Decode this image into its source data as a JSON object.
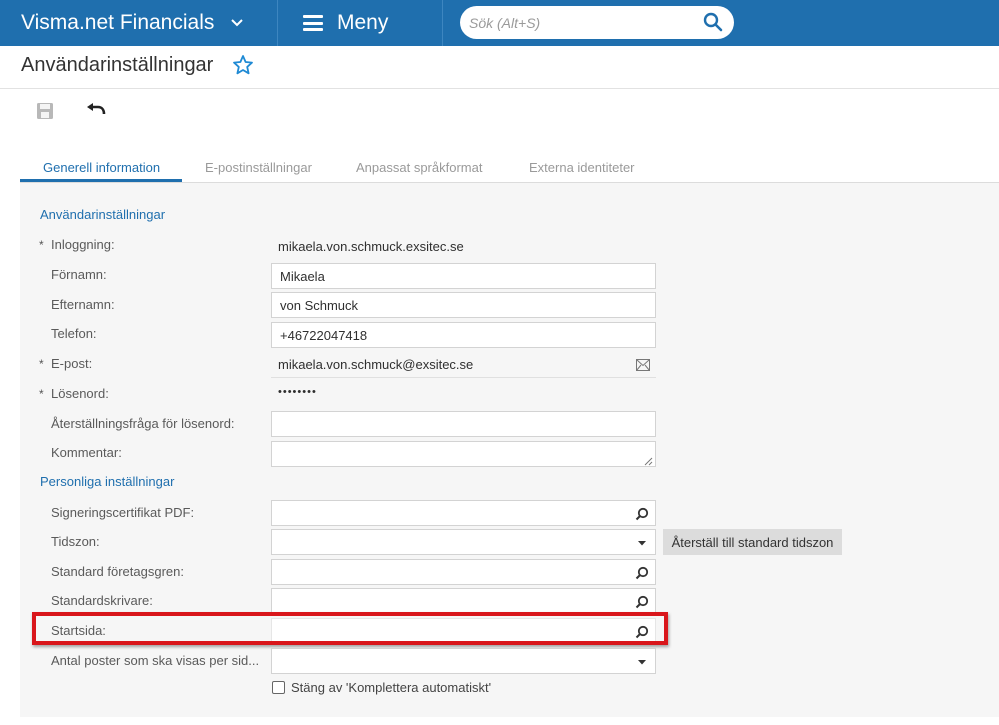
{
  "topbar": {
    "brand": "Visma.net Financials",
    "menu_label": "Meny",
    "search_placeholder": "Sök (Alt+S)"
  },
  "page": {
    "title": "Användarinställningar"
  },
  "tabs": [
    {
      "label": "Generell information"
    },
    {
      "label": "E-postinställningar"
    },
    {
      "label": "Anpassat språkformat"
    },
    {
      "label": "Externa identiteter"
    }
  ],
  "sections": {
    "user": "Användarinställningar",
    "personal": "Personliga inställningar"
  },
  "fields": {
    "login": {
      "label": "Inloggning:",
      "value": "mikaela.von.schmuck.exsitec.se"
    },
    "firstname": {
      "label": "Förnamn:",
      "value": "Mikaela"
    },
    "lastname": {
      "label": "Efternamn:",
      "value": "von Schmuck"
    },
    "phone": {
      "label": "Telefon:",
      "value": "+46722047418"
    },
    "email": {
      "label": "E-post:",
      "value": "mikaela.von.schmuck@exsitec.se"
    },
    "password": {
      "label": "Lösenord:",
      "value": "••••••••"
    },
    "reset_question": {
      "label": "Återställningsfråga för lösenord:",
      "value": ""
    },
    "comment": {
      "label": "Kommentar:",
      "value": ""
    },
    "sign_cert": {
      "label": "Signeringscertifikat PDF:",
      "value": ""
    },
    "timezone": {
      "label": "Tidszon:",
      "value": ""
    },
    "branch": {
      "label": "Standard företagsgren:",
      "value": ""
    },
    "printer": {
      "label": "Standardskrivare:",
      "value": ""
    },
    "startpage": {
      "label": "Startsida:",
      "value": ""
    },
    "rows_per_page": {
      "label": "Antal poster som ska visas per sid...",
      "value": ""
    }
  },
  "required_mark": "*",
  "buttons": {
    "reset_timezone": "Återställ till standard tidszon"
  },
  "checkbox": {
    "autocomplete_label": "Stäng av 'Komplettera automatiskt'",
    "checked": false
  },
  "colors": {
    "brand_blue": "#1f6fae",
    "highlight_red": "#d9161b"
  }
}
